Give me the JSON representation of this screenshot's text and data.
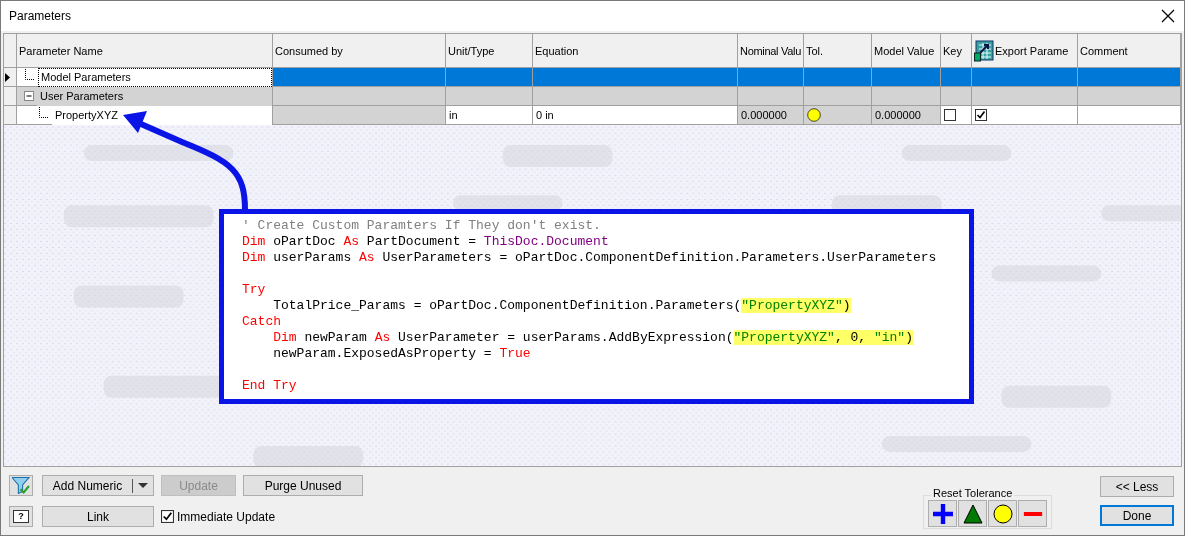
{
  "window": {
    "title": "Parameters"
  },
  "table": {
    "columns": [
      {
        "label": "Parameter Name",
        "icon": false
      },
      {
        "label": "Consumed by",
        "icon": false
      },
      {
        "label": "Unit/Type",
        "icon": false
      },
      {
        "label": "Equation",
        "icon": false
      },
      {
        "label": "Nominal Valu",
        "icon": false
      },
      {
        "label": "Tol.",
        "icon": false
      },
      {
        "label": "Model Value",
        "icon": false
      },
      {
        "label": "Key",
        "icon": false
      },
      {
        "label": "Export Parame",
        "icon": true
      },
      {
        "label": "Comment",
        "icon": false
      }
    ],
    "rows": [
      {
        "name": "Model Parameters",
        "selected": true,
        "kind": "group"
      },
      {
        "name": "User Parameters",
        "selected": false,
        "kind": "group",
        "expanded": true,
        "children": [
          {
            "name": "PropertyXYZ",
            "selected": false,
            "kind": "parameter",
            "unit": "in",
            "equation": "0 in",
            "nominal": "0.000000",
            "tolerance": {
              "kind": "nominal"
            },
            "model_value": "0.000000",
            "key": false,
            "export": true
          }
        ]
      }
    ]
  },
  "code": {
    "lines": [
      {
        "space_after": false,
        "segments": [
          {
            "text": "' Create Custom Paramters If They don't exist.",
            "kind": "comment",
            "highlighted": false
          }
        ]
      },
      {
        "space_after": false,
        "segments": [
          {
            "text": "Dim",
            "kind": "keyword",
            "highlighted": false
          },
          {
            "text": " oPartDoc ",
            "kind": "plain",
            "highlighted": false
          },
          {
            "text": "As",
            "kind": "keyword",
            "highlighted": false
          },
          {
            "text": " PartDocument = ",
            "kind": "plain",
            "highlighted": false
          },
          {
            "text": "ThisDoc.Document",
            "kind": "builtin",
            "highlighted": false
          }
        ]
      },
      {
        "space_after": true,
        "segments": [
          {
            "text": "Dim",
            "kind": "keyword",
            "highlighted": false
          },
          {
            "text": " userParams ",
            "kind": "plain",
            "highlighted": false
          },
          {
            "text": "As",
            "kind": "keyword",
            "highlighted": false
          },
          {
            "text": " UserParameters = oPartDoc.ComponentDefinition.Parameters.UserParameters",
            "kind": "plain",
            "highlighted": false
          }
        ]
      },
      {
        "space_after": false,
        "segments": [
          {
            "text": "Try",
            "kind": "keyword",
            "highlighted": false
          }
        ]
      },
      {
        "space_after": false,
        "segments": [
          {
            "text": "    TotalPrice_Params = oPartDoc.ComponentDefinition.Parameters(",
            "kind": "plain",
            "highlighted": false
          },
          {
            "text": "\"PropertyXYZ\"",
            "kind": "string",
            "highlighted": true
          },
          {
            "text": ")",
            "kind": "plain",
            "highlighted": true
          }
        ]
      },
      {
        "space_after": false,
        "segments": [
          {
            "text": "Catch",
            "kind": "keyword",
            "highlighted": false
          }
        ]
      },
      {
        "space_after": false,
        "segments": [
          {
            "text": "    Dim",
            "kind": "keyword",
            "highlighted": false
          },
          {
            "text": " newParam ",
            "kind": "plain",
            "highlighted": false
          },
          {
            "text": "As",
            "kind": "keyword",
            "highlighted": false
          },
          {
            "text": " UserParameter = userParams.AddByExpression(",
            "kind": "plain",
            "highlighted": false
          },
          {
            "text": "\"PropertyXYZ\"",
            "kind": "string",
            "highlighted": true
          },
          {
            "text": ", 0, ",
            "kind": "plain",
            "highlighted": true
          },
          {
            "text": "\"in\"",
            "kind": "string",
            "highlighted": true
          },
          {
            "text": ")",
            "kind": "plain",
            "highlighted": true
          }
        ]
      },
      {
        "space_after": true,
        "segments": [
          {
            "text": "    newParam.ExposedAsProperty = ",
            "kind": "plain",
            "highlighted": false
          },
          {
            "text": "True",
            "kind": "keyword",
            "highlighted": false
          }
        ]
      },
      {
        "space_after": false,
        "segments": [
          {
            "text": "End Try",
            "kind": "keyword",
            "highlighted": false
          }
        ]
      }
    ]
  },
  "buttons": {
    "add_numeric": "Add Numeric",
    "update": {
      "label": "Update",
      "disabled": true
    },
    "purge": "Purge Unused",
    "help": "?",
    "link": "Link",
    "immediate_update": {
      "label": "Immediate Update",
      "checked": true
    }
  },
  "reset_tolerance": {
    "label": "Reset Tolerance",
    "buttons": [
      {
        "kind": "upper"
      },
      {
        "kind": "median"
      },
      {
        "kind": "nominal"
      },
      {
        "kind": "lower"
      }
    ]
  },
  "less": "<< Less",
  "done": "Done"
}
